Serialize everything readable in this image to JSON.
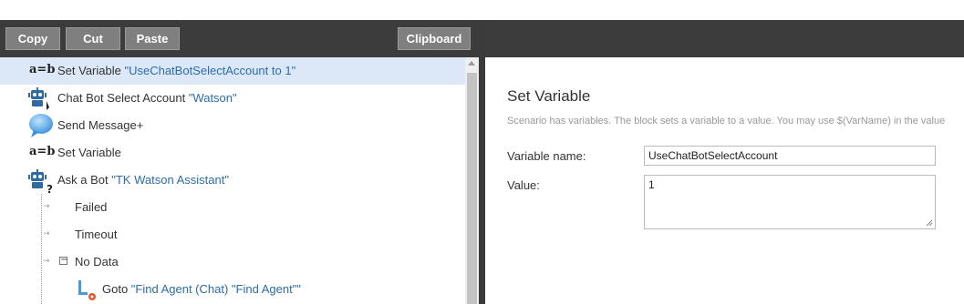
{
  "toolbar": {
    "copy": "Copy",
    "cut": "Cut",
    "paste": "Paste",
    "clipboard": "Clipboard"
  },
  "tree": {
    "rows": [
      {
        "label": "Set Variable ",
        "value": "\"UseChatBotSelectAccount to 1\"",
        "icon": "variable-icon"
      },
      {
        "label": "Chat Bot Select Account ",
        "value": "\"Watson\"",
        "icon": "robot-icon"
      },
      {
        "label": "Send Message+",
        "icon": "chat-bubble-icon"
      },
      {
        "label": "Set Variable",
        "icon": "variable-icon"
      },
      {
        "label": "Ask a Bot ",
        "value": "\"TK Watson Assistant\"",
        "icon": "robot-question-icon"
      },
      {
        "label": "Failed"
      },
      {
        "label": "Timeout"
      },
      {
        "label": "No Data",
        "toggle": "−"
      },
      {
        "label": "Goto ",
        "value": "\"Find Agent (Chat) \"Find Agent\"\"",
        "icon": "goto-icon"
      }
    ],
    "ab_glyph": "a=b"
  },
  "properties": {
    "title": "Set Variable",
    "description": "Scenario has variables. The block sets a variable to a value. You may use $(VarName) in the value",
    "variable_name_label": "Variable name:",
    "variable_name_value": "UseChatBotSelectAccount",
    "value_label": "Value:",
    "value_value": "1"
  },
  "colors": {
    "toolbar": "#3c3c3c",
    "selected_row": "#dce8f7",
    "link": "#2b6cb0",
    "branch": "#5b8a2c",
    "robot": "#2f6aa3"
  }
}
